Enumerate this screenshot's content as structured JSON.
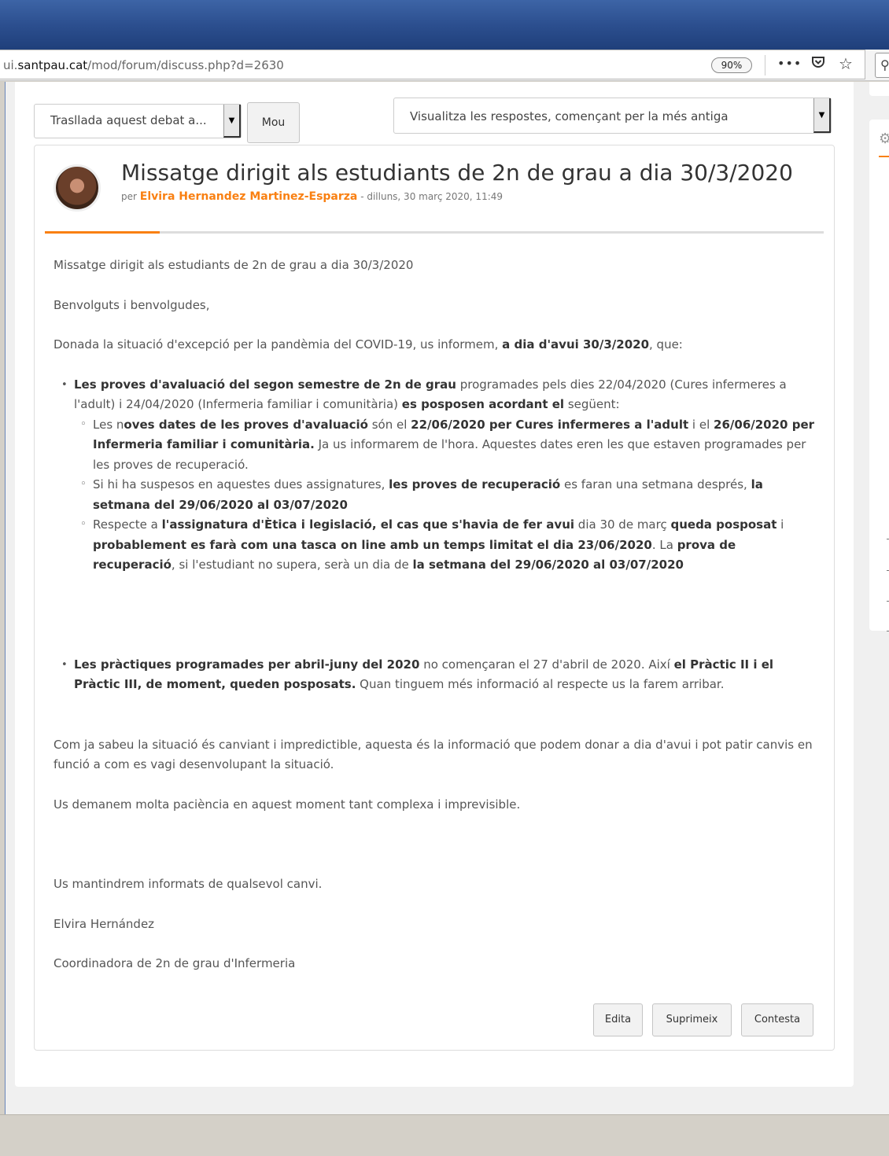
{
  "browser": {
    "url_prefix": "ui.",
    "url_domain": "santpau.cat",
    "url_path": "/mod/forum/discuss.php?d=2630",
    "zoom": "90%",
    "icons": [
      "more-icon",
      "pocket-icon",
      "bookmark-star-icon",
      "search-icon"
    ]
  },
  "controls": {
    "move_select": "Trasllada aquest debat a...",
    "move_button": "Mou",
    "display_select": "Visualitza les respostes, començant per la més antiga"
  },
  "post": {
    "title": "Missatge dirigit als estudiants de 2n de grau a dia 30/3/2020",
    "by": "per",
    "author": "Elvira Hernandez Martinez-Esparza",
    "date": "- dilluns, 30 març 2020, 11:49",
    "p1": "Missatge dirigit als estudiants de 2n de grau a dia 30/3/2020",
    "p2": "Benvolguts i benvolgudes,",
    "p3a": "Donada la situació d'excepció per la pandèmia del COVID-19, us informem, ",
    "p3b": "a dia d'avui 30/3/2020",
    "p3c": ", que:",
    "b1a": "Les proves d'avaluació del segon semestre de 2n de grau",
    "b1b": " programades pels dies 22/04/2020 (Cures infermeres a l'adult) i 24/04/2020 (Infermeria familiar i comunitària) ",
    "b1c": "es posposen acordant el",
    "b1d": " següent:",
    "s1a": "Les n",
    "s1b": "oves dates de les proves d'avaluació",
    "s1c": " són el ",
    "s1d": "22/06/2020 per Cures infermeres a l'adult",
    "s1e": " i el ",
    "s1f": "26/06/2020 per Infermeria familiar i comunitària.",
    "s1g": " Ja us informarem de l'hora. Aquestes dates eren les que estaven programades per les proves de recuperació.",
    "s2a": "Si hi ha suspesos en aquestes dues assignatures, ",
    "s2b": "les proves de recuperació",
    "s2c": " es faran una setmana després, ",
    "s2d": "la setmana del 29/06/2020 al 03/07/2020",
    "s3a": "Respecte a ",
    "s3b": "l'assignatura d'Ètica i legislació, el cas que s'havia de fer avui",
    "s3c": " dia 30 de març ",
    "s3d": "queda posposat",
    "s3e": " i ",
    "s3f": "probablement es farà com una tasca on line amb un temps limitat el  dia 23/06/2020",
    "s3g": ". La ",
    "s3h": "prova de recuperació",
    "s3i": ", si l'estudiant no supera, serà  un dia de  ",
    "s3j": "la setmana del 29/06/2020 al 03/07/2020",
    "b2a": "Les pràctiques programades per abril-juny del 2020",
    "b2b": " no començaran el 27 d'abril de 2020",
    "b2c": ". Així ",
    "b2d": "el Pràctic II i el Pràctic III, de moment, queden posposats.",
    "b2e": " Quan tinguem més informació al respecte us la farem arribar.",
    "p4": "Com ja sabeu la situació és canviant i impredictible, aquesta és la informació que podem donar a dia d'avui i pot patir canvis en funció a com es vagi desenvolupant la situació.",
    "p5": "Us demanem molta paciència en aquest moment tant  complexa i imprevisible.",
    "p6": "Us mantindrem informats de qualsevol canvi.",
    "p7": "Elvira Hernández",
    "p8": "Coordinadora de 2n de grau d'Infermeria"
  },
  "actions": {
    "edit": "Edita",
    "delete": "Suprimeix",
    "reply": "Contesta"
  }
}
